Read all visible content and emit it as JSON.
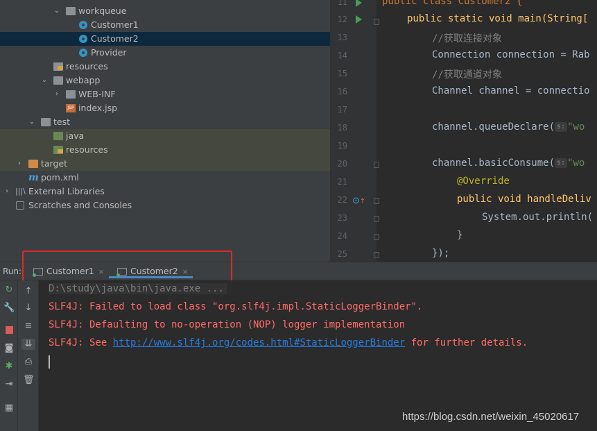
{
  "project_tree": [
    {
      "label": "workqueue",
      "icon": "folder-icon",
      "indent": 94,
      "chevron": "down"
    },
    {
      "label": "Customer1",
      "icon": "java-class-icon",
      "indent": 112
    },
    {
      "label": "Customer2",
      "icon": "java-class-icon",
      "indent": 112,
      "selected": true
    },
    {
      "label": "Provider",
      "icon": "java-class-icon",
      "indent": 112
    },
    {
      "label": "resources",
      "icon": "resources-folder-icon",
      "indent": 76
    },
    {
      "label": "webapp",
      "icon": "folder-icon",
      "indent": 76,
      "chevron": "down"
    },
    {
      "label": "WEB-INF",
      "icon": "folder-icon",
      "indent": 94,
      "chevron": "right"
    },
    {
      "label": "index.jsp",
      "icon": "jsp-file-icon",
      "indent": 94
    },
    {
      "label": "test",
      "icon": "folder-icon",
      "indent": 58,
      "chevron": "down"
    },
    {
      "label": "java",
      "icon": "test-folder-icon",
      "indent": 76
    },
    {
      "label": "resources",
      "icon": "test-resources-folder-icon",
      "indent": 76
    },
    {
      "label": "target",
      "icon": "folder-icon",
      "indent": 40,
      "chevron": "right"
    },
    {
      "label": "pom.xml",
      "icon": "maven-icon",
      "indent": 40
    },
    {
      "label": "External Libraries",
      "icon": "libraries-icon",
      "indent": 22,
      "chevron": "right"
    },
    {
      "label": "Scratches and Consoles",
      "icon": "scratches-icon",
      "indent": 22
    }
  ],
  "editor": {
    "line_numbers": [
      "11",
      "12",
      "13",
      "14",
      "15",
      "16",
      "17",
      "18",
      "19",
      "20",
      "21",
      "22",
      "23",
      "24",
      "25"
    ],
    "top_line": "public class Customer2 {",
    "main_sig": "public static void main(String[",
    "comment_connection": "//获取连接对象",
    "connection_line": "Connection connection = Rab",
    "comment_channel": "//获取通道对象",
    "channel_line": "Channel channel = connectio",
    "queue_declare": "channel.queueDeclare(",
    "basic_consume": "channel.basicConsume(",
    "param_hint": "s:",
    "string_frag": "\"wo",
    "override": "@Override",
    "handle_delivery": "public void handleDeliv",
    "println": "System.out.println(",
    "close_brace": "}",
    "close_paren": "});"
  },
  "run_panel": {
    "label": "Run:",
    "tabs": [
      {
        "label": "Customer1",
        "close": "×"
      },
      {
        "label": "Customer2",
        "close": "×",
        "active": true
      }
    ]
  },
  "console": {
    "command": "D:\\study\\java\\bin\\java.exe ...",
    "line1": "SLF4J: Failed to load class \"org.slf4j.impl.StaticLoggerBinder\".",
    "line2": "SLF4J: Defaulting to no-operation (NOP) logger implementation",
    "line3_prefix": "SLF4J: See ",
    "line3_link": "http://www.slf4j.org/codes.html#StaticLoggerBinder",
    "line3_suffix": " for further details."
  },
  "watermark": "https://blog.csdn.net/weixin_45020617",
  "colors": {
    "accent_run": "#499c54",
    "error_text": "#ff6b68",
    "link": "#287bde",
    "highlight_box": "#e0282c"
  }
}
